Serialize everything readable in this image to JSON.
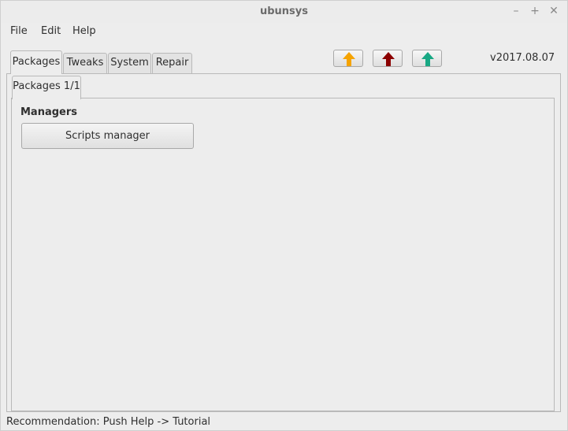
{
  "window": {
    "title": "ubunsys",
    "controls": {
      "minimize": "–",
      "maximize": "+",
      "close": "✕"
    }
  },
  "menu": {
    "file": "File",
    "edit": "Edit",
    "help": "Help"
  },
  "tabs": [
    {
      "label": "Packages",
      "active": true
    },
    {
      "label": "Tweaks",
      "active": false
    },
    {
      "label": "System",
      "active": false
    },
    {
      "label": "Repair",
      "active": false
    }
  ],
  "toolbar": {
    "buttons": [
      {
        "icon": "arrow-up-orange-icon",
        "color": "#f5a300"
      },
      {
        "icon": "arrow-up-red-icon",
        "color": "#8b0000"
      },
      {
        "icon": "arrow-up-green-icon",
        "color": "#18a884"
      }
    ],
    "version": "v2017.08.07"
  },
  "subtab": {
    "label": "Packages 1/1"
  },
  "content": {
    "section_label": "Managers",
    "scripts_manager_button": "Scripts manager"
  },
  "status": {
    "text": "Recommendation: Push Help -> Tutorial"
  }
}
